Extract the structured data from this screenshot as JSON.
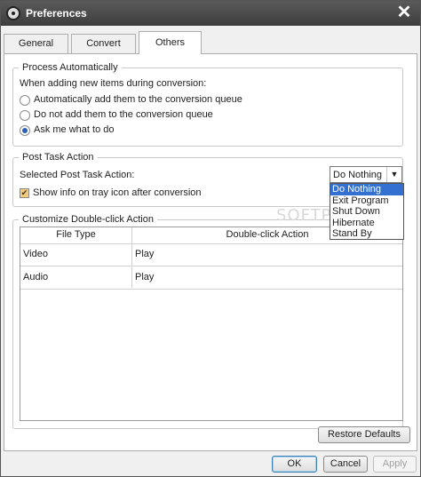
{
  "window": {
    "title": "Preferences",
    "icon": "film-reel-icon"
  },
  "tabs": [
    {
      "label": "General",
      "active": false
    },
    {
      "label": "Convert",
      "active": false
    },
    {
      "label": "Others",
      "active": true
    }
  ],
  "process_auto": {
    "legend": "Process Automatically",
    "prompt": "When adding new items during conversion:",
    "options": [
      {
        "label": "Automatically add them to the conversion queue",
        "checked": false
      },
      {
        "label": "Do not add them to the conversion queue",
        "checked": false
      },
      {
        "label": "Ask me what to do",
        "checked": true
      }
    ]
  },
  "post_task": {
    "legend": "Post Task Action",
    "select_label": "Selected Post Task Action:",
    "selected": "Do Nothing",
    "options": [
      "Do Nothing",
      "Exit Program",
      "Shut Down",
      "Hibernate",
      "Stand By"
    ],
    "tray_label": "Show info on tray icon after conversion",
    "tray_checked": true
  },
  "dblclick": {
    "legend": "Customize Double-click Action",
    "headers": [
      "File Type",
      "Double-click Action"
    ],
    "rows": [
      {
        "type": "Video",
        "action": "Play"
      },
      {
        "type": "Audio",
        "action": "Play"
      }
    ]
  },
  "buttons": {
    "restore": "Restore Defaults",
    "ok": "OK",
    "cancel": "Cancel",
    "apply": "Apply"
  },
  "watermark": "SOFTP",
  "colors": {
    "titlebar": "#3d3d3d",
    "selection": "#3370cf",
    "checkbox": "#f3c97a"
  }
}
